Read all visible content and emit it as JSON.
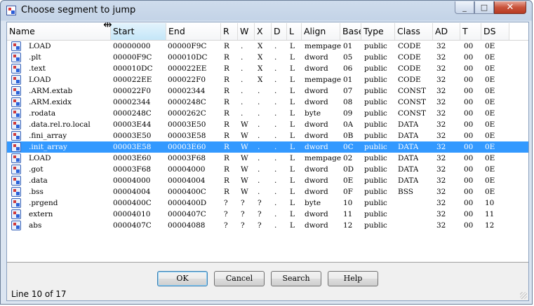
{
  "window": {
    "title": "Choose segment to jump"
  },
  "columns": [
    "Name",
    "Start",
    "End",
    "R",
    "W",
    "X",
    "D",
    "L",
    "Align",
    "Base",
    "Type",
    "Class",
    "AD",
    "T",
    "DS"
  ],
  "rows": [
    [
      "LOAD",
      "00000000",
      "00000F9C",
      "R",
      ".",
      "X",
      ".",
      "L",
      "mempage",
      "01",
      "public",
      "CODE",
      "32",
      "00",
      "0E"
    ],
    [
      ".plt",
      "00000F9C",
      "000010DC",
      "R",
      ".",
      "X",
      ".",
      "L",
      "dword",
      "05",
      "public",
      "CODE",
      "32",
      "00",
      "0E"
    ],
    [
      ".text",
      "000010DC",
      "000022EE",
      "R",
      ".",
      "X",
      ".",
      "L",
      "dword",
      "06",
      "public",
      "CODE",
      "32",
      "00",
      "0E"
    ],
    [
      "LOAD",
      "000022EE",
      "000022F0",
      "R",
      ".",
      "X",
      ".",
      "L",
      "mempage",
      "01",
      "public",
      "CODE",
      "32",
      "00",
      "0E"
    ],
    [
      ".ARM.extab",
      "000022F0",
      "00002344",
      "R",
      ".",
      ".",
      ".",
      "L",
      "dword",
      "07",
      "public",
      "CONST",
      "32",
      "00",
      "0E"
    ],
    [
      ".ARM.exidx",
      "00002344",
      "0000248C",
      "R",
      ".",
      ".",
      ".",
      "L",
      "dword",
      "08",
      "public",
      "CONST",
      "32",
      "00",
      "0E"
    ],
    [
      ".rodata",
      "0000248C",
      "0000262C",
      "R",
      ".",
      ".",
      ".",
      "L",
      "byte",
      "09",
      "public",
      "CONST",
      "32",
      "00",
      "0E"
    ],
    [
      ".data.rel.ro.local",
      "00003E44",
      "00003E50",
      "R",
      "W",
      ".",
      ".",
      "L",
      "dword",
      "0A",
      "public",
      "DATA",
      "32",
      "00",
      "0E"
    ],
    [
      ".fini_array",
      "00003E50",
      "00003E58",
      "R",
      "W",
      ".",
      ".",
      "L",
      "dword",
      "0B",
      "public",
      "DATA",
      "32",
      "00",
      "0E"
    ],
    [
      ".init_array",
      "00003E58",
      "00003E60",
      "R",
      "W",
      ".",
      ".",
      "L",
      "dword",
      "0C",
      "public",
      "DATA",
      "32",
      "00",
      "0E"
    ],
    [
      "LOAD",
      "00003E60",
      "00003F68",
      "R",
      "W",
      ".",
      ".",
      "L",
      "mempage",
      "02",
      "public",
      "DATA",
      "32",
      "00",
      "0E"
    ],
    [
      ".got",
      "00003F68",
      "00004000",
      "R",
      "W",
      ".",
      ".",
      "L",
      "dword",
      "0D",
      "public",
      "DATA",
      "32",
      "00",
      "0E"
    ],
    [
      ".data",
      "00004000",
      "00004004",
      "R",
      "W",
      ".",
      ".",
      "L",
      "dword",
      "0E",
      "public",
      "DATA",
      "32",
      "00",
      "0E"
    ],
    [
      ".bss",
      "00004004",
      "0000400C",
      "R",
      "W",
      ".",
      ".",
      "L",
      "dword",
      "0F",
      "public",
      "BSS",
      "32",
      "00",
      "0E"
    ],
    [
      ".prgend",
      "0000400C",
      "0000400D",
      "?",
      "?",
      "?",
      ".",
      "L",
      "byte",
      "10",
      "public",
      "",
      "32",
      "00",
      "10"
    ],
    [
      "extern",
      "00004010",
      "0000407C",
      "?",
      "?",
      "?",
      ".",
      "L",
      "dword",
      "11",
      "public",
      "",
      "32",
      "00",
      "11"
    ],
    [
      "abs",
      "0000407C",
      "00004088",
      "?",
      "?",
      "?",
      ".",
      "L",
      "dword",
      "12",
      "public",
      "",
      "32",
      "00",
      "12"
    ]
  ],
  "selected_row": 9,
  "buttons": {
    "ok": "OK",
    "cancel": "Cancel",
    "search": "Search",
    "help": "Help"
  },
  "status": "Line 10 of 17",
  "colors": {
    "selection": "#3399ff"
  }
}
